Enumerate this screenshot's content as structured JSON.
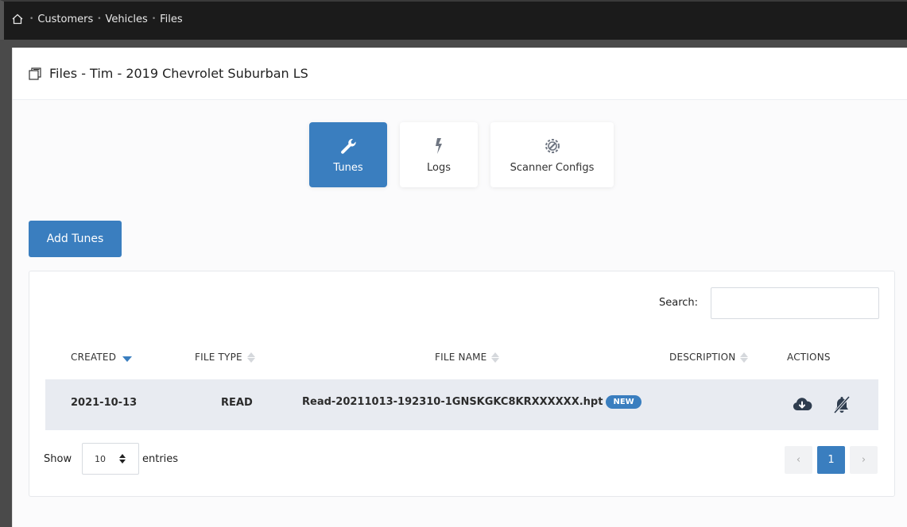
{
  "breadcrumb": {
    "items": [
      "Customers",
      "Vehicles",
      "Files"
    ],
    "separator": "•"
  },
  "panel": {
    "title": "Files - Tim - 2019 Chevrolet Suburban LS"
  },
  "tabs": [
    {
      "label": "Tunes",
      "icon": "wrench-icon",
      "active": true
    },
    {
      "label": "Logs",
      "icon": "bolt-icon",
      "active": false
    },
    {
      "label": "Scanner Configs",
      "icon": "gear-wrench-icon",
      "active": false
    }
  ],
  "add_button": "Add Tunes",
  "table": {
    "search_label": "Search:",
    "search_value": "",
    "columns": [
      "CREATED",
      "FILE TYPE",
      "FILE NAME",
      "DESCRIPTION",
      "ACTIONS"
    ],
    "rows": [
      {
        "created": "2021-10-13",
        "file_type": "READ",
        "file_name": "Read-20211013-192310-1GNSKGKC8KRXXXXXX.hpt",
        "badge": "NEW",
        "description": "",
        "actions": [
          "cloud-download-icon",
          "bell-slash-icon"
        ]
      }
    ],
    "show_label": "Show",
    "page_length": "10",
    "entries_label": "entries",
    "pagination": {
      "prev": "‹",
      "current": "1",
      "next": "›"
    }
  },
  "colors": {
    "accent": "#3a7ebf",
    "row_bg": "#e8ebf1",
    "topbar": "#1b1b1b"
  }
}
